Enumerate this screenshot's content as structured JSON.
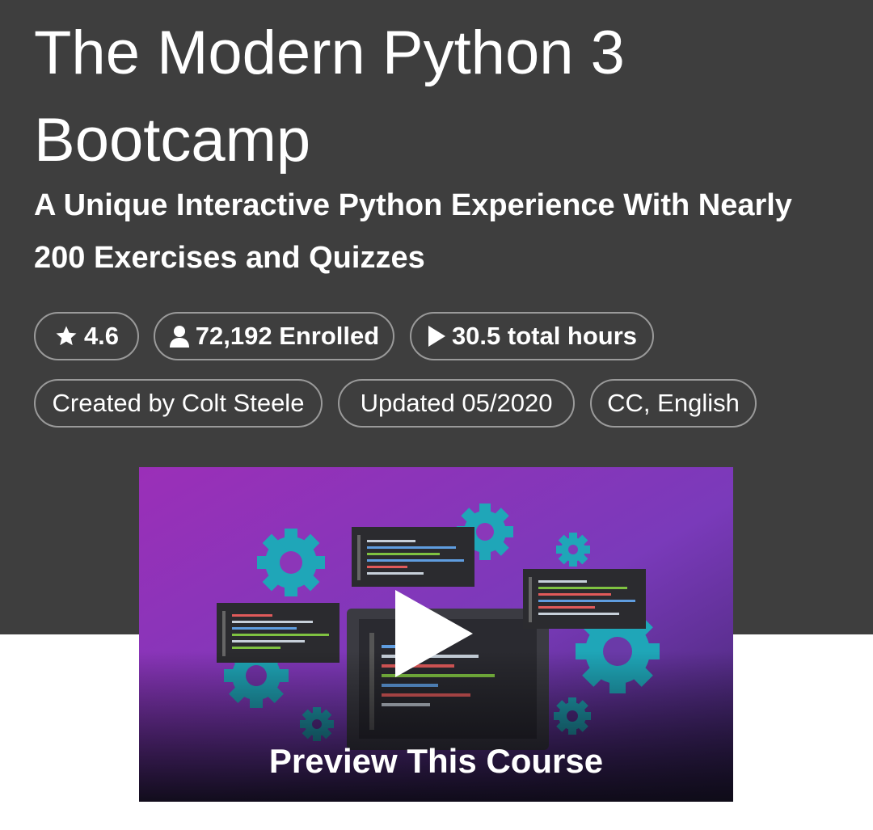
{
  "course": {
    "title": "The Modern Python 3 Bootcamp",
    "subtitle": "A Unique Interactive Python Experience With Nearly 200 Exercises and Quizzes"
  },
  "stats": {
    "rating": "4.6",
    "enrolled": "72,192 Enrolled",
    "hours": "30.5 total hours"
  },
  "meta": {
    "author": "Created by Colt Steele",
    "updated": "Updated 05/2020",
    "captions": "CC, English"
  },
  "preview": {
    "label": "Preview This Course"
  },
  "icons": {
    "rating": "star-icon",
    "enrolled": "user-icon",
    "hours": "play-icon",
    "preview": "play-button-icon"
  },
  "colors": {
    "header_bg": "#3e3e3e",
    "chip_border": "#9a9a9a",
    "video_purple": "#8e35b8",
    "gear_teal": "#1fa6b8"
  }
}
